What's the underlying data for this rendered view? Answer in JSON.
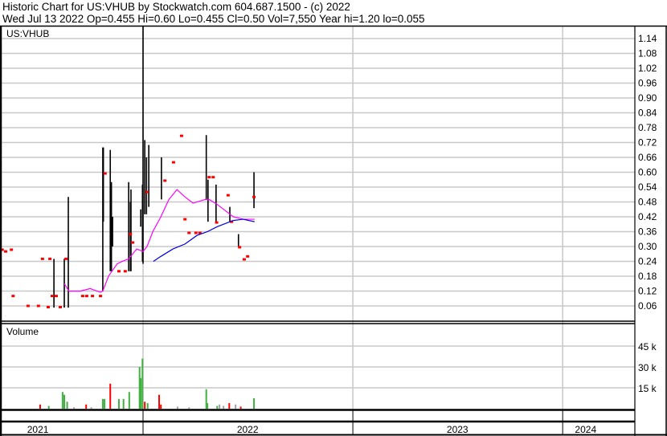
{
  "header": {
    "title": "Historic Chart for US:VHUB by Stockwatch.com 604.687.1500 - (c) 2022",
    "quote": "Wed Jul 13 2022  Op=0.455  Hi=0.60  Lo=0.455  Cl=0.50  Vol=7,550  Year hi=1.20  lo=0.055"
  },
  "colors": {
    "up": "#40b040",
    "down": "#ff0000",
    "flat": "#a0a0a0",
    "ma_short": "#ff00ff",
    "ma_long": "#0000dd",
    "grid": "#c8c8c8"
  },
  "chart_data": {
    "type": "ohlc",
    "symbol": "US:VHUB",
    "x_unit": "days from 2022-01-01",
    "price_axis": {
      "ticks": [
        "0.06",
        "0.12",
        "0.18",
        "0.24",
        "0.30",
        "0.36",
        "0.42",
        "0.48",
        "0.54",
        "0.60",
        "0.66",
        "0.72",
        "0.78",
        "0.84",
        "0.90",
        "0.96",
        "1.02",
        "1.08",
        "1.14"
      ],
      "range": [
        0.0,
        1.2
      ]
    },
    "volume_panel": {
      "label": "Volume",
      "ticks": [
        "15 k",
        "30 k",
        "45 k"
      ],
      "range": [
        0,
        55000
      ]
    },
    "year_labels": [
      {
        "label": "2021",
        "day": -183
      },
      {
        "label": "2022",
        "day": 182
      },
      {
        "label": "2023",
        "day": 547
      },
      {
        "label": "2024",
        "day": 770
      }
    ],
    "year_dividers": [
      0,
      365,
      730
    ],
    "bars": [
      [
        -155,
        0.25,
        0.053
      ],
      [
        -137,
        0.25,
        0.053
      ],
      [
        -130,
        0.5,
        0.053
      ],
      [
        -70,
        0.7,
        0.12
      ],
      [
        -69,
        0.7,
        0.4
      ],
      [
        -57,
        0.69,
        0.2
      ],
      [
        -55,
        0.56,
        0.2
      ],
      [
        -53,
        0.42,
        0.3
      ],
      [
        -25,
        0.56,
        0.2
      ],
      [
        -22,
        0.48,
        0.2
      ],
      [
        -21,
        0.53,
        0.2
      ],
      [
        -4,
        0.45,
        0.38
      ],
      [
        -1,
        0.55,
        0.24
      ],
      [
        0,
        1.2,
        0.23
      ],
      [
        3,
        0.73,
        0.43
      ],
      [
        6,
        0.66,
        0.43
      ],
      [
        10,
        0.71,
        0.46
      ],
      [
        32,
        0.66,
        0.49
      ],
      [
        110,
        0.75,
        0.49
      ],
      [
        113,
        0.57,
        0.4
      ],
      [
        127,
        0.55,
        0.4
      ],
      [
        151,
        0.46,
        0.4
      ],
      [
        166,
        0.35,
        0.3
      ],
      [
        193,
        0.6,
        0.455
      ]
    ],
    "closes": [
      [
        -245,
        0.287
      ],
      [
        -239,
        0.28
      ],
      [
        -229,
        0.287
      ],
      [
        -226,
        0.1
      ],
      [
        -200,
        0.06
      ],
      [
        -182,
        0.06
      ],
      [
        -175,
        0.25
      ],
      [
        -162,
        0.25
      ],
      [
        -158,
        0.1
      ],
      [
        -151,
        0.1
      ],
      [
        -134,
        0.25
      ],
      [
        -165,
        0.055
      ],
      [
        -144,
        0.055
      ],
      [
        -105,
        0.1
      ],
      [
        -98,
        0.1
      ],
      [
        -88,
        0.1
      ],
      [
        -74,
        0.1
      ],
      [
        -66,
        0.595
      ],
      [
        -42,
        0.2
      ],
      [
        -31,
        0.2
      ],
      [
        -22,
        0.35
      ],
      [
        -18,
        0.316
      ],
      [
        7,
        0.52
      ],
      [
        38,
        0.566
      ],
      [
        53,
        0.64
      ],
      [
        67,
        0.747
      ],
      [
        73,
        0.41
      ],
      [
        80,
        0.355
      ],
      [
        92,
        0.355
      ],
      [
        99,
        0.355
      ],
      [
        115,
        0.58
      ],
      [
        122,
        0.58
      ],
      [
        128,
        0.397
      ],
      [
        148,
        0.507
      ],
      [
        154,
        0.4
      ],
      [
        168,
        0.297
      ],
      [
        176,
        0.248
      ],
      [
        182,
        0.26
      ],
      [
        193,
        0.5
      ]
    ],
    "ma_short": [
      [
        -137,
        0.15
      ],
      [
        -129,
        0.12
      ],
      [
        -109,
        0.12
      ],
      [
        -92,
        0.13
      ],
      [
        -74,
        0.115
      ],
      [
        -70,
        0.12
      ],
      [
        -60,
        0.18
      ],
      [
        -45,
        0.23
      ],
      [
        -36,
        0.24
      ],
      [
        -25,
        0.25
      ],
      [
        -11,
        0.29
      ],
      [
        0,
        0.28
      ],
      [
        7,
        0.3
      ],
      [
        17,
        0.36
      ],
      [
        31,
        0.42
      ],
      [
        45,
        0.49
      ],
      [
        59,
        0.53
      ],
      [
        73,
        0.5
      ],
      [
        87,
        0.475
      ],
      [
        108,
        0.49
      ],
      [
        115,
        0.49
      ],
      [
        129,
        0.47
      ],
      [
        157,
        0.42
      ],
      [
        175,
        0.41
      ],
      [
        194,
        0.41
      ]
    ],
    "ma_long": [
      [
        18,
        0.24
      ],
      [
        31,
        0.26
      ],
      [
        52,
        0.29
      ],
      [
        73,
        0.31
      ],
      [
        94,
        0.345
      ],
      [
        112,
        0.36
      ],
      [
        129,
        0.38
      ],
      [
        157,
        0.405
      ],
      [
        174,
        0.41
      ],
      [
        194,
        0.4
      ]
    ],
    "volume": [
      [
        -179,
        3000,
        "down"
      ],
      [
        -164,
        2000,
        "up"
      ],
      [
        -140,
        12000,
        "up"
      ],
      [
        -137,
        10000,
        "up"
      ],
      [
        -132,
        5000,
        "up"
      ],
      [
        -99,
        3000,
        "down"
      ],
      [
        -70,
        7000,
        "up"
      ],
      [
        -67,
        7000,
        "up"
      ],
      [
        -57,
        18000,
        "down"
      ],
      [
        -42,
        7000,
        "up"
      ],
      [
        -34,
        7000,
        "up"
      ],
      [
        -24,
        12000,
        "up"
      ],
      [
        -6,
        30000,
        "up"
      ],
      [
        -4,
        22000,
        "up"
      ],
      [
        -1,
        36000,
        "up"
      ],
      [
        3,
        5000,
        "down"
      ],
      [
        8,
        4000,
        "up"
      ],
      [
        28,
        10000,
        "down"
      ],
      [
        31,
        3000,
        "down"
      ],
      [
        110,
        14000,
        "up"
      ],
      [
        112,
        4000,
        "up"
      ],
      [
        129,
        2000,
        "up"
      ],
      [
        133,
        3000,
        "flat"
      ],
      [
        150,
        4000,
        "down"
      ],
      [
        161,
        3000,
        "flat"
      ],
      [
        193,
        7550,
        "up"
      ],
      [
        -120,
        1000,
        "flat"
      ],
      [
        -90,
        1000,
        "flat"
      ],
      [
        60,
        1500,
        "flat"
      ],
      [
        80,
        1000,
        "flat"
      ],
      [
        140,
        2000,
        "flat"
      ],
      [
        170,
        1500,
        "down"
      ]
    ]
  }
}
